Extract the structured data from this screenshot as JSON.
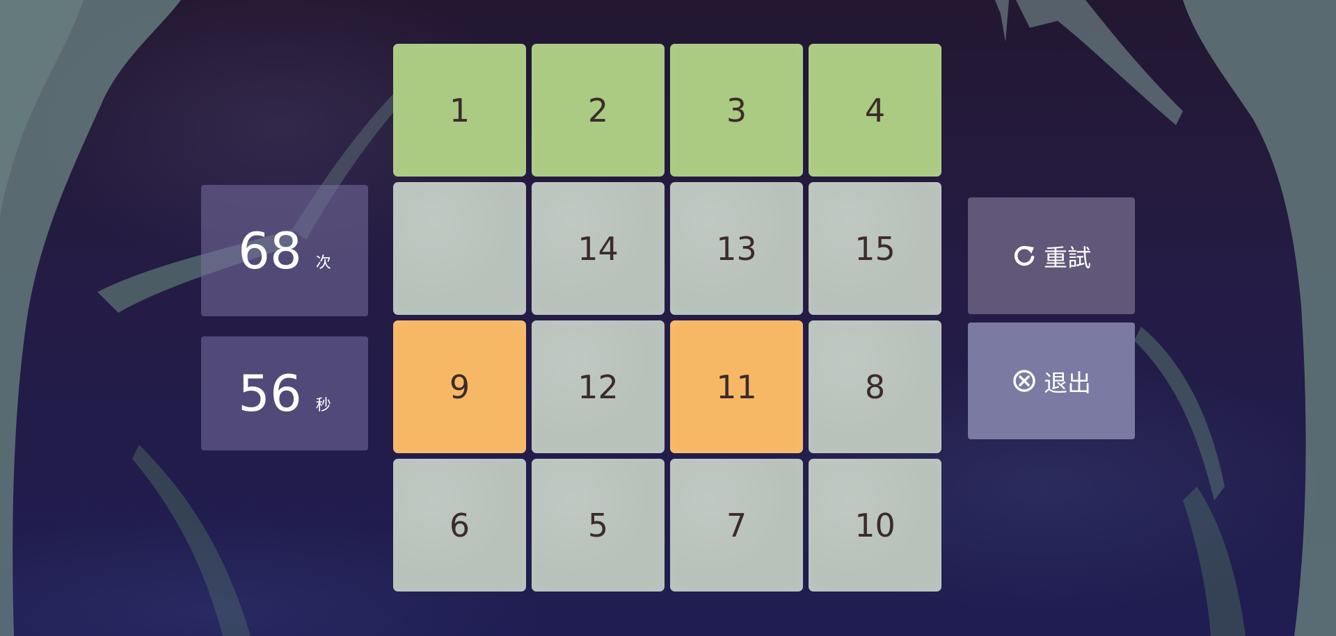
{
  "stats": {
    "moves": {
      "value": "68",
      "unit": "次"
    },
    "time": {
      "value": "56",
      "unit": "秒"
    }
  },
  "board": {
    "tiles": [
      {
        "label": "1",
        "state": "done"
      },
      {
        "label": "2",
        "state": "done"
      },
      {
        "label": "3",
        "state": "done"
      },
      {
        "label": "4",
        "state": "done"
      },
      {
        "label": "",
        "state": "empty"
      },
      {
        "label": "14",
        "state": "normal"
      },
      {
        "label": "13",
        "state": "normal"
      },
      {
        "label": "15",
        "state": "normal"
      },
      {
        "label": "9",
        "state": "hint"
      },
      {
        "label": "12",
        "state": "normal"
      },
      {
        "label": "11",
        "state": "hint"
      },
      {
        "label": "8",
        "state": "normal"
      },
      {
        "label": "6",
        "state": "normal"
      },
      {
        "label": "5",
        "state": "normal"
      },
      {
        "label": "7",
        "state": "normal"
      },
      {
        "label": "10",
        "state": "normal"
      }
    ]
  },
  "buttons": {
    "retry": {
      "label": "重試",
      "icon": "redo-icon"
    },
    "quit": {
      "label": "退出",
      "icon": "close-circle-icon"
    }
  },
  "colors": {
    "done_tile": "#abca82",
    "normal_tile": "#b8c2bb",
    "hint_tile": "#f7b865",
    "retry_button": "#605779",
    "quit_button": "#7a7aa2"
  }
}
